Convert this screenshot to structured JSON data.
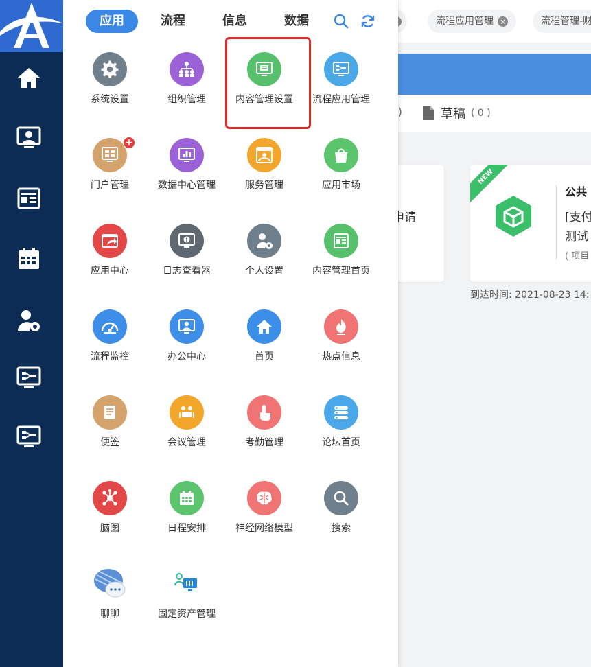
{
  "panel": {
    "tabs": [
      "应用",
      "流程",
      "信息",
      "数据"
    ],
    "apps": [
      {
        "label": "系统设置",
        "icon": "gear-icon",
        "color": "#6f7f8b"
      },
      {
        "label": "组织管理",
        "icon": "org-chart-icon",
        "color": "#9a62d6"
      },
      {
        "label": "内容管理设置",
        "icon": "monitor-doc-icon",
        "color": "#56c06d"
      },
      {
        "label": "流程应用管理",
        "icon": "monitor-flow-icon",
        "color": "#4aa8e8"
      },
      {
        "label": "门户管理",
        "icon": "portal-grid-icon",
        "color": "#d4a26b",
        "badge": "+"
      },
      {
        "label": "数据中心管理",
        "icon": "bar-chart-icon",
        "color": "#9a62d6"
      },
      {
        "label": "服务管理",
        "icon": "service-icon",
        "color": "#f2a62b"
      },
      {
        "label": "应用市场",
        "icon": "shopping-bag-icon",
        "color": "#5cc46c"
      },
      {
        "label": "应用中心",
        "icon": "app-share-icon",
        "color": "#e34848"
      },
      {
        "label": "日志查看器",
        "icon": "log-viewer-icon",
        "color": "#5f6770"
      },
      {
        "label": "个人设置",
        "icon": "user-settings-icon",
        "color": "#6f7f8b"
      },
      {
        "label": "内容管理首页",
        "icon": "news-icon",
        "color": "#56c06d"
      },
      {
        "label": "流程监控",
        "icon": "gauge-icon",
        "color": "#3d8ee6"
      },
      {
        "label": "办公中心",
        "icon": "office-user-icon",
        "color": "#3d8ee6"
      },
      {
        "label": "首页",
        "icon": "home-icon",
        "color": "#3d8ee6"
      },
      {
        "label": "热点信息",
        "icon": "fire-icon",
        "color": "#f07474"
      },
      {
        "label": "便签",
        "icon": "note-icon",
        "color": "#d4a26b"
      },
      {
        "label": "会议管理",
        "icon": "meeting-icon",
        "color": "#f2a62b"
      },
      {
        "label": "考勤管理",
        "icon": "touch-icon",
        "color": "#f07474"
      },
      {
        "label": "论坛首页",
        "icon": "forum-icon",
        "color": "#4aa8e8"
      },
      {
        "label": "脑图",
        "icon": "mind-map-icon",
        "color": "#e34848"
      },
      {
        "label": "日程安排",
        "icon": "calendar-icon",
        "color": "#5cc46c"
      },
      {
        "label": "神经网络模型",
        "icon": "brain-icon",
        "color": "#f07474"
      },
      {
        "label": "搜索",
        "icon": "search-icon",
        "color": "#6f7f8b"
      },
      {
        "label": "聊聊",
        "icon": "chat-bubble-icon",
        "color": "#3d8ee6"
      },
      {
        "label": "固定资产管理",
        "icon": "asset-screen-icon",
        "color": "#2fb8a8"
      }
    ]
  },
  "background": {
    "tabs": [
      "流程应用管理",
      "流程管理-财"
    ],
    "draft_label": "草稿",
    "draft_count": "( 0 )",
    "card1_text": "申请",
    "card2_badge": "NEW",
    "card2_title": "公共",
    "card2_line1": "[支付",
    "card2_line2": "测试",
    "card2_line3": "( 项目",
    "arrival": "到达时间: 2021-08-23 14:"
  },
  "colors": {
    "sidebar": "#0d2c55",
    "logo": "#2f6ad0",
    "accent": "#3b87e6",
    "highlight": "#e22b2b"
  }
}
